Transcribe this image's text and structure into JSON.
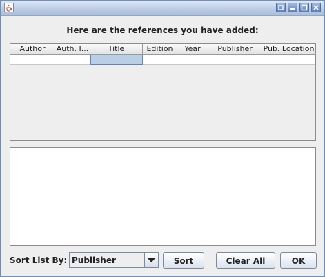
{
  "window": {
    "icons": {
      "app": "java-cup-icon",
      "iconify": "iconify-icon",
      "minimize": "minimize-icon",
      "maximize": "maximize-icon",
      "close": "close-icon"
    }
  },
  "heading": "Here are the references you have added:",
  "table": {
    "columns": [
      "Author",
      "Auth. I...",
      "Title",
      "Edition",
      "Year",
      "Publisher",
      "Pub. Location"
    ],
    "rows": [
      [
        "",
        "",
        "",
        "",
        "",
        "",
        ""
      ]
    ],
    "selected_cell": "Title"
  },
  "details_area": {
    "value": ""
  },
  "sort": {
    "label": "Sort List By:",
    "selected": "Publisher",
    "button_label": "Sort"
  },
  "buttons": {
    "clear_all": "Clear All",
    "ok": "OK"
  },
  "colors": {
    "accent": "#b8cfe5",
    "titlebar": "#b9cbe4"
  }
}
